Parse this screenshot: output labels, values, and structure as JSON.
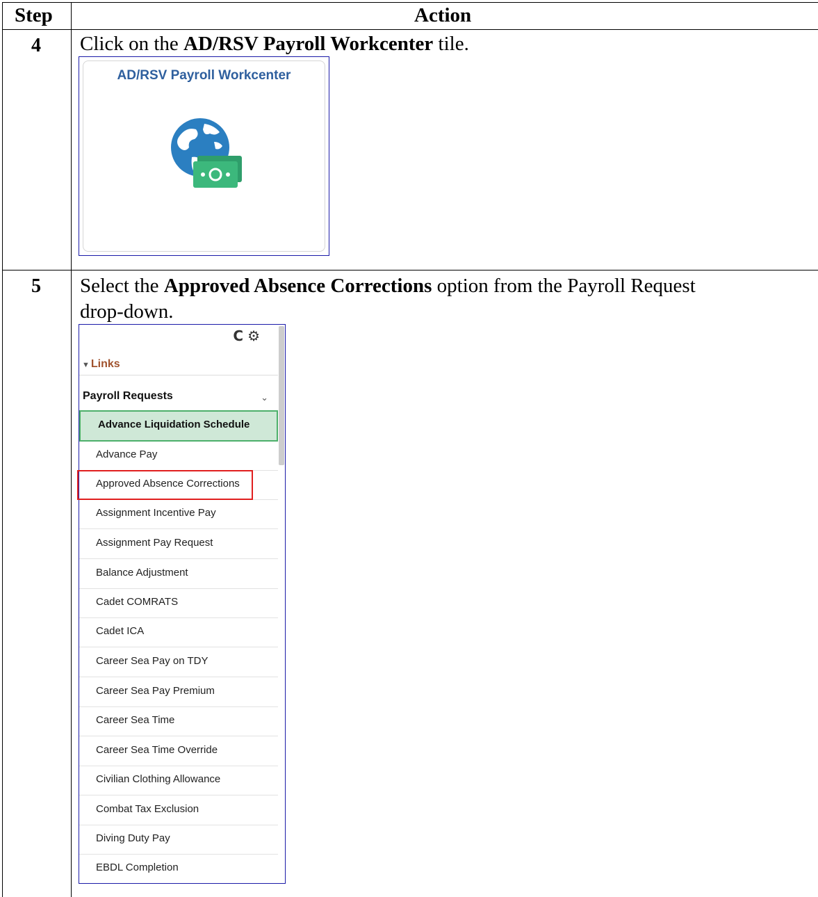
{
  "table": {
    "header_step": "Step",
    "header_action": "Action"
  },
  "step4": {
    "number": "4",
    "text_before": "Click on the ",
    "text_bold": "AD/RSV Payroll Workcenter",
    "text_after": " tile.",
    "tile_title": "AD/RSV Payroll Workcenter",
    "tile_icon": "globe-money-icon"
  },
  "step5": {
    "number": "5",
    "line1_before": "Select the ",
    "line1_bold": "Approved Absence Corrections",
    "line1_after": " option from the Payroll Request",
    "line2": "drop-down."
  },
  "panel": {
    "refresh_icon": "C",
    "gear_icon": "⚙",
    "links_label": "Links",
    "section_label": "Payroll Requests",
    "selected_item": "Advance Liquidation Schedule",
    "items": [
      "Advance Pay",
      "Approved Absence Corrections",
      "Assignment Incentive Pay",
      "Assignment Pay Request",
      "Balance Adjustment",
      "Cadet COMRATS",
      "Cadet ICA",
      "Career Sea Pay on TDY",
      "Career Sea Pay Premium",
      "Career Sea Time",
      "Career Sea Time Override",
      "Civilian Clothing Allowance",
      "Combat Tax Exclusion",
      "Diving Duty Pay",
      "EBDL Completion"
    ],
    "highlighted_item": "Approved Absence Corrections"
  },
  "colors": {
    "tile_title": "#2e5f9e",
    "selected_bg": "#cfe8d7",
    "selected_border": "#4caf6a",
    "highlight_border": "#e01e1e",
    "frame_border": "#1a1aa8",
    "links_label": "#a0522d"
  }
}
